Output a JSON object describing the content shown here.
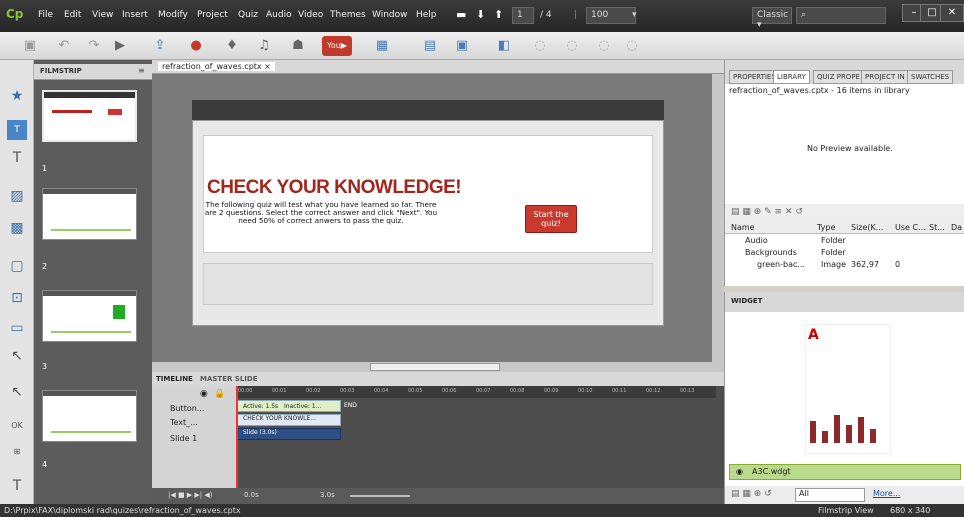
{
  "menubar": {
    "logo": "Cp",
    "items": [
      "File",
      "Edit",
      "View",
      "Insert",
      "Modify",
      "Project",
      "Quiz",
      "Audio",
      "Video",
      "Themes",
      "Window",
      "Help"
    ],
    "page_current": "1",
    "page_total": "/ 4",
    "zoom": "100",
    "workspace": "Classic ▾"
  },
  "filmstrip": {
    "tab": "FILMSTRIP",
    "slide_numbers": [
      "1",
      "2",
      "3",
      "4"
    ]
  },
  "document": {
    "tab": "refraction_of_waves.cptx ×"
  },
  "slide": {
    "title": "CHECK YOUR KNOWLEDGE!",
    "body": "The following quiz will test what you have learned so far. There are 2 questions. Select the correct answer and click \"Next\". You need 50% of correct anwers to pass the quiz.",
    "start_button": "Start the quiz!"
  },
  "timeline": {
    "tabs": [
      "TIMELINE",
      "MASTER SLIDE"
    ],
    "times": [
      "00:00",
      "00:01",
      "00:02",
      "00:03",
      "00:04",
      "00:05",
      "00:06",
      "00:07",
      "00:08",
      "00:09",
      "00:10",
      "00:11",
      "00:12",
      "00:13"
    ],
    "rows": [
      "Button...",
      "Text_...",
      "Slide 1"
    ],
    "active_label": "Active: 1.5s",
    "inactive_label": "Inactive: 1...",
    "end_label": "END",
    "text_label": "CHECK YOUR KNOWLE...",
    "slide_label": "Slide (3.0s)",
    "time_a": "0.0s",
    "time_b": "3.0s"
  },
  "right": {
    "tabs": [
      "PROPERTIES",
      "LIBRARY",
      "QUIZ PROPE",
      "PROJECT IN",
      "SWATCHES"
    ],
    "library_info": "refraction_of_waves.cptx - 16 items in library",
    "no_preview": "No Preview available.",
    "columns": [
      "Name",
      "Type",
      "Size(K...",
      "Use C...",
      "St...",
      "Da"
    ],
    "items": [
      {
        "name": "Audio",
        "type": "Folder",
        "size": "",
        "use": ""
      },
      {
        "name": "Backgrounds",
        "type": "Folder",
        "size": "",
        "use": ""
      },
      {
        "name": "green-bac...",
        "type": "Image",
        "size": "362,97",
        "use": "0"
      }
    ]
  },
  "widget": {
    "tab": "WIDGET",
    "name": "A3C.wdgt",
    "filter": "All",
    "more": "More..."
  },
  "status": {
    "path": "D:\\Prpix\\FAX\\diplomski rad\\quizes\\refraction_of_waves.cptx",
    "view": "Filmstrip View",
    "size": "680 x 340"
  }
}
